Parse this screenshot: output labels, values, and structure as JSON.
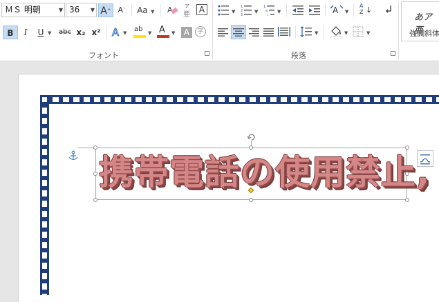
{
  "ribbon": {
    "font_name": "ＭＳ 明朝",
    "font_size": "36",
    "grow_font_label": "A",
    "shrink_font_label": "A",
    "change_case_label": "Aa",
    "bold_label": "B",
    "italic_label": "I",
    "underline_label": "U",
    "strikethrough_label": "abc",
    "subscript_label": "x₂",
    "superscript_label": "x²",
    "text_effects_label": "A",
    "highlight_label": "ab",
    "font_color_label": "A",
    "char_shading_label": "A",
    "enclosed_char_label": "字",
    "phonetic_guide_label": "亜",
    "char_border_label": "A",
    "sort_label": "A",
    "sort_label2": "Z",
    "font_group_label": "フォント",
    "paragraph_group_label": "段落",
    "style_sample": "あア亜",
    "style_name": "強調斜体",
    "highlight_color": "#ffe600",
    "font_color": "#c0392b"
  },
  "document": {
    "wordart_text": "携帯電話の使用禁止,",
    "wordart_color": "#d58686",
    "border_color": "#1f3d7a"
  }
}
